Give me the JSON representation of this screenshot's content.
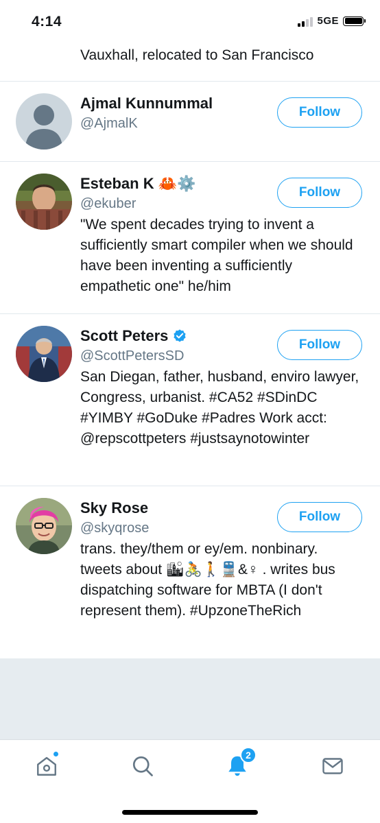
{
  "status_bar": {
    "time": "4:14",
    "network": "5GE"
  },
  "partial_bio": "Vauxhall, relocated to San Francisco",
  "users": [
    {
      "name": "Ajmal Kunnummal",
      "handle": "@AjmalK",
      "follow_label": "Follow",
      "description": ""
    },
    {
      "name": "Esteban K 🦀⚙️",
      "handle": "@ekuber",
      "follow_label": "Follow",
      "description": "\"We spent decades trying to invent a sufficiently smart compiler when we should have been inventing a sufficiently empathetic one\" he/him"
    },
    {
      "name": "Scott Peters",
      "verified": true,
      "handle": "@ScottPetersSD",
      "follow_label": "Follow",
      "description": "San Diegan, father, husband, enviro lawyer, Congress, urbanist. #CA52 #SDinDC #YIMBY #GoDuke #Padres Work acct: @repscottpeters #justsaynotowinter"
    },
    {
      "name": "Sky Rose",
      "handle": "@skyqrose",
      "follow_label": "Follow",
      "description": "trans. they/them or ey/em. nonbinary. tweets about 🏙🚴🚶🚆&♀ . writes bus dispatching software for MBTA (I don't represent them). #UpzoneTheRich"
    }
  ],
  "tab_bar": {
    "items": [
      "home-icon",
      "search-icon",
      "notifications-icon",
      "messages-icon"
    ],
    "notifications_badge": "2",
    "accent": "#1da1f2"
  }
}
